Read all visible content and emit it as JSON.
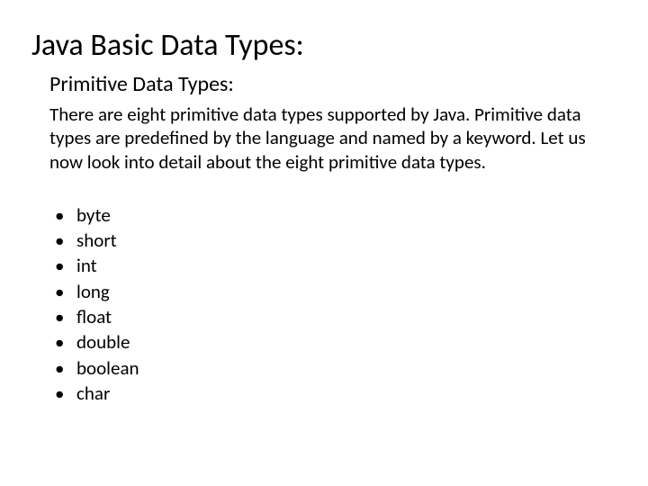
{
  "title": "Java Basic Data Types:",
  "subtitle": "Primitive Data Types:",
  "description": "There are eight primitive data types supported by Java. Primitive data types are predefined by the language and named by a keyword. Let us now look into detail about the eight primitive data types.",
  "bullet": "•",
  "types": {
    "0": "byte",
    "1": "short",
    "2": "int",
    "3": "long",
    "4": "float",
    "5": "double",
    "6": "boolean",
    "7": "char"
  }
}
